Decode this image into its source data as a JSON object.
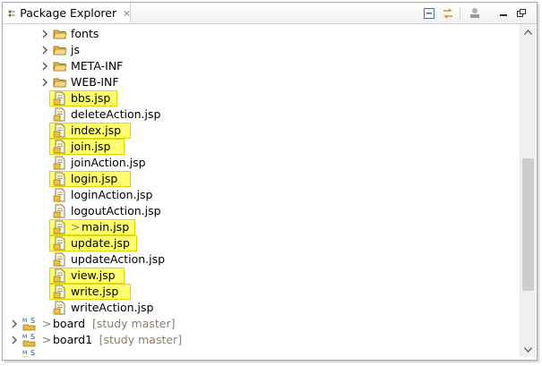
{
  "view": {
    "title": "Package Explorer"
  },
  "toolbar": {
    "collapse_icon": "collapse-all-icon",
    "link_icon": "link-with-editor-icon",
    "menu_icon": "view-menu-icon",
    "minimize_icon": "minimize-icon",
    "maximize_icon": "maximize-icon"
  },
  "tree": {
    "items": [
      {
        "label": "fonts",
        "type": "folder",
        "expandable": true
      },
      {
        "label": "js",
        "type": "folder",
        "expandable": true
      },
      {
        "label": "META-INF",
        "type": "folder",
        "expandable": true
      },
      {
        "label": "WEB-INF",
        "type": "folder",
        "expandable": true
      },
      {
        "label": "bbs.jsp",
        "type": "jsp",
        "highlighted": true,
        "modified": false
      },
      {
        "label": "deleteAction.jsp",
        "type": "jsp",
        "highlighted": false,
        "modified": false
      },
      {
        "label": "index.jsp",
        "type": "jsp",
        "highlighted": true,
        "modified": false
      },
      {
        "label": "join.jsp",
        "type": "jsp",
        "highlighted": true,
        "modified": false
      },
      {
        "label": "joinAction.jsp",
        "type": "jsp",
        "highlighted": false,
        "modified": false
      },
      {
        "label": "login.jsp",
        "type": "jsp",
        "highlighted": true,
        "modified": false
      },
      {
        "label": "loginAction.jsp",
        "type": "jsp",
        "highlighted": false,
        "modified": false
      },
      {
        "label": "logoutAction.jsp",
        "type": "jsp",
        "highlighted": false,
        "modified": false
      },
      {
        "label": "main.jsp",
        "type": "jsp",
        "highlighted": true,
        "modified": true,
        "prefix": ">"
      },
      {
        "label": "update.jsp",
        "type": "jsp",
        "highlighted": true,
        "modified": false
      },
      {
        "label": "updateAction.jsp",
        "type": "jsp",
        "highlighted": false,
        "modified": false
      },
      {
        "label": "view.jsp",
        "type": "jsp",
        "highlighted": true,
        "modified": false
      },
      {
        "label": "write.jsp",
        "type": "jsp",
        "highlighted": true,
        "modified": false
      },
      {
        "label": "writeAction.jsp",
        "type": "jsp",
        "highlighted": false,
        "modified": false
      }
    ],
    "projects": [
      {
        "prefix": ">",
        "name": "board",
        "repo": "[study master]"
      },
      {
        "prefix": ">",
        "name": "board1",
        "repo": "[study master]"
      }
    ]
  },
  "colors": {
    "highlight": "#ffff70",
    "highlight_border": "#e6d400",
    "repo_text": "#8c7e6a",
    "folder": "#e8b84a"
  }
}
